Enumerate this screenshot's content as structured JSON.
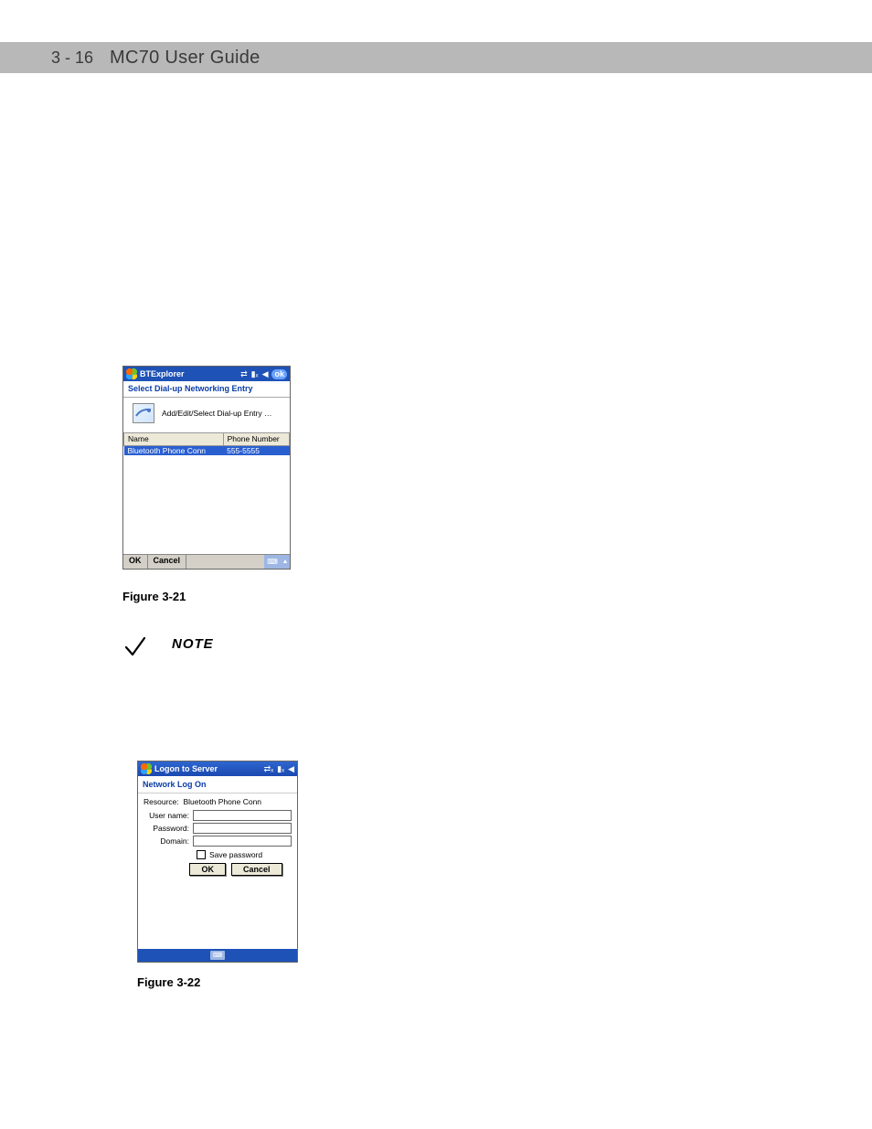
{
  "header": {
    "page_marker": "3 - 16",
    "title": "MC70 User Guide"
  },
  "figure1": {
    "title": "BTExplorer",
    "ok": "ok",
    "subtitle": "Select Dial-up Networking Entry",
    "edit_label": "Add/Edit/Select Dial-up Entry …",
    "col_name": "Name",
    "col_phone": "Phone Number",
    "row_name": "Bluetooth Phone Conn",
    "row_phone": "555-5555",
    "btn_ok": "OK",
    "btn_cancel": "Cancel",
    "caption": "Figure 3-21"
  },
  "note": {
    "label": "NOTE"
  },
  "figure2": {
    "title": "Logon to Server",
    "subtitle": "Network Log On",
    "resource_label": "Resource:",
    "resource_value": "Bluetooth Phone Conn",
    "username_label": "User name:",
    "password_label": "Password:",
    "domain_label": "Domain:",
    "save_pw": "Save password",
    "ok": "OK",
    "cancel": "Cancel",
    "caption": "Figure 3-22"
  }
}
